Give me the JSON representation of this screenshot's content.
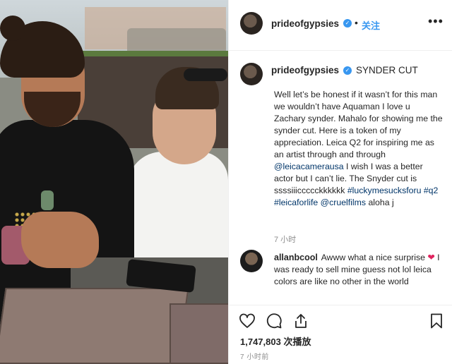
{
  "post": {
    "username": "prideofgypsies",
    "follow_label": "关注",
    "more_label": "•••",
    "dot_separator": "•"
  },
  "caption": {
    "username": "prideofgypsies",
    "title": "SYNDER CUT",
    "text_1": "Well let’s be honest if it wasn’t for this man we wouldn’t have Aquaman I love u Zachary synder. Mahalo for showing me the synder cut. Here is a token of my appreciation. Leica Q2 for inspiring me as an artist through and through ",
    "mention_leica": "@leicacamerausa",
    "text_2": " I wish I was a better actor but I can’t lie. The Snyder cut is ssssiiiccccckkkkkk ",
    "hashtag_1": "#luckymesucksforu",
    "hashtag_2": "#q2",
    "hashtag_3": "#leicaforlife",
    "mention_cruel": "@cruelfilms",
    "text_3": " aloha j",
    "time": "7 小时"
  },
  "comment": {
    "username": "allanbcool",
    "text_1": "Awww what a nice surprise ",
    "emoji": "❤",
    "text_2": " I was ready to sell mine guess not lol leica colors are like no other in the world"
  },
  "stats": {
    "views": "1,747,803 次播放",
    "date": "7 小时前"
  },
  "icons": {
    "like": "heart-icon",
    "comment": "comment-icon",
    "share": "share-icon",
    "save": "bookmark-icon",
    "verified": "verified-badge-icon"
  },
  "colors": {
    "link": "#003569",
    "follow": "#3897f0",
    "verified": "#3897f0",
    "muted": "#8e8e8e"
  }
}
